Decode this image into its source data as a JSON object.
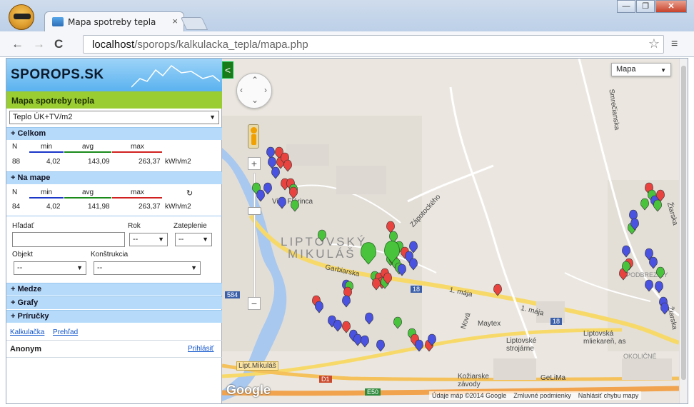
{
  "browser": {
    "tab_title": "Mapa spotreby tepla",
    "tab_close": "×",
    "win_buttons": [
      "—",
      "❐",
      "✕"
    ],
    "nav_back": "←",
    "nav_forward": "→",
    "nav_reload": "C",
    "url_host": "localhost",
    "url_path": "/sporops/kalkulacka_tepla/mapa.php",
    "bookmark_icon": "☆",
    "menu_icon": "≡"
  },
  "sidebar": {
    "logo_text": "SPOROPS.SK",
    "title": "Mapa spotreby tepla",
    "metric_select": "Teplo ÚK+TV/m2",
    "celkom": {
      "header": "+ Celkom",
      "labels": [
        "N",
        "min",
        "avg",
        "max"
      ],
      "values": [
        "88",
        "4,02",
        "143,09",
        "263,37",
        "kWh/m2"
      ]
    },
    "na_mape": {
      "header": "+ Na mape",
      "labels": [
        "N",
        "min",
        "avg",
        "max"
      ],
      "refresh_icon": "↻",
      "values": [
        "84",
        "4,02",
        "141,98",
        "263,37",
        "kWh/m2"
      ]
    },
    "filters": {
      "search_label": "Hľadať",
      "search_value": "",
      "rok_label": "Rok",
      "rok_value": "--",
      "zateplenie_label": "Zateplenie",
      "zateplenie_value": "--",
      "objekt_label": "Objekt",
      "objekt_value": "--",
      "konstrukcia_label": "Konštrukcia",
      "konstrukcia_value": "--"
    },
    "sections": [
      "+ Medze",
      "+ Grafy",
      "+ Príručky"
    ],
    "links": [
      "Kalkulačka",
      "Prehľad"
    ],
    "user": "Anonym",
    "login": "Prihlásiť"
  },
  "map": {
    "collapse_icon": "<",
    "map_type": "Mapa",
    "labels": {
      "city1": "LIPTOVSKÝ",
      "city2": "MIKULÁŠ",
      "villa": "Villa Flórinca",
      "garbiarska": "Garbiarska",
      "maja1": "1. mája",
      "maja2": "1. mája",
      "zapotockeho": "Zápotockého",
      "smrecianska": "Smrečianska",
      "ziarska": "Žiarska",
      "ziarska2": "Žiarska",
      "podbrezin": "PODBREZINY",
      "okolicne": "OKOLIČNÉ",
      "maytex": "Maytex",
      "strojarne": "Liptovské strojárne",
      "mliekaren": "Liptovská mliekareň, as",
      "kozi": "Kožiarske závody",
      "gelima": "GeLiMa",
      "nova": "Nová",
      "road584": "584",
      "road18a": "18",
      "road18b": "18",
      "d1": "D1",
      "e50": "E50",
      "liptmik": "Lipt.Mikuláš"
    },
    "google": "Google",
    "footer": [
      "Údaje máp ©2014 Google",
      "Zmluvné podmienky",
      "Nahlásiť chybu mapy"
    ],
    "marker_colors": {
      "red": "#e8433f",
      "blue": "#4a52e0",
      "green": "#49c23c"
    }
  }
}
